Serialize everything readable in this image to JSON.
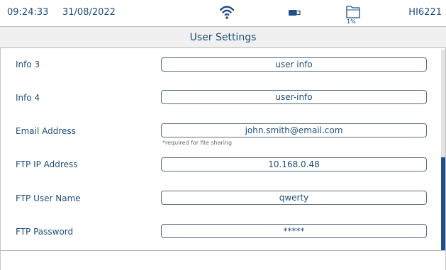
{
  "status_bar": {
    "time": "09:24:33",
    "date": "31/08/2022",
    "storage_percent": "1%",
    "model": "HI6221",
    "icons": [
      "wifi-icon",
      "usb-icon",
      "folder-icon"
    ]
  },
  "title": "User Settings",
  "fields": [
    {
      "label": "Info 3",
      "value": "user info"
    },
    {
      "label": "Info 4",
      "value": "user-info"
    },
    {
      "label": "Email Address",
      "value": "john.smith@email.com",
      "hint": "*required for file sharing"
    },
    {
      "label": "FTP IP Address",
      "value": "10.168.0.48"
    },
    {
      "label": "FTP User Name",
      "value": "qwerty"
    },
    {
      "label": "FTP Password",
      "value": "*****"
    }
  ],
  "scrollbar": {
    "position_fraction": 0.55,
    "visible_fraction": 0.46
  },
  "colors": {
    "text": "#1f4e79",
    "accent": "#1f4e8a",
    "border": "#b9b9b9"
  }
}
